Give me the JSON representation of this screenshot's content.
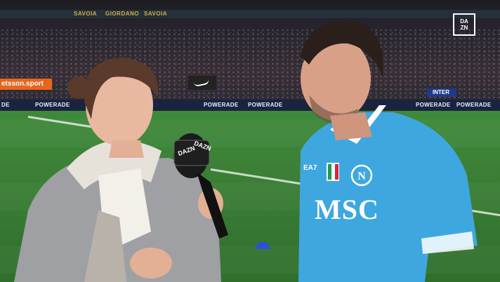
{
  "broadcaster_logo": {
    "line1": "DA",
    "line2": "ZN"
  },
  "upper_tier_boards": [
    "SAVOIA",
    "GIORDANO",
    "SAVOIA"
  ],
  "sponsor_left": "etsson.sport",
  "ad_boards": [
    "DE",
    "POWERADE",
    "POWERADE",
    "POWERADE",
    "POWERADE",
    "POWERADE"
  ],
  "inter_board": "INTER",
  "microphone_flag": {
    "left": "DAZN",
    "right": "DAZN"
  },
  "player_shirt": {
    "sponsor": "MSC",
    "kit_maker": "EA7"
  },
  "colors": {
    "shirt": "#3fa7e0",
    "pitch": "#3b7f36",
    "coat": "#9ea0a4"
  }
}
